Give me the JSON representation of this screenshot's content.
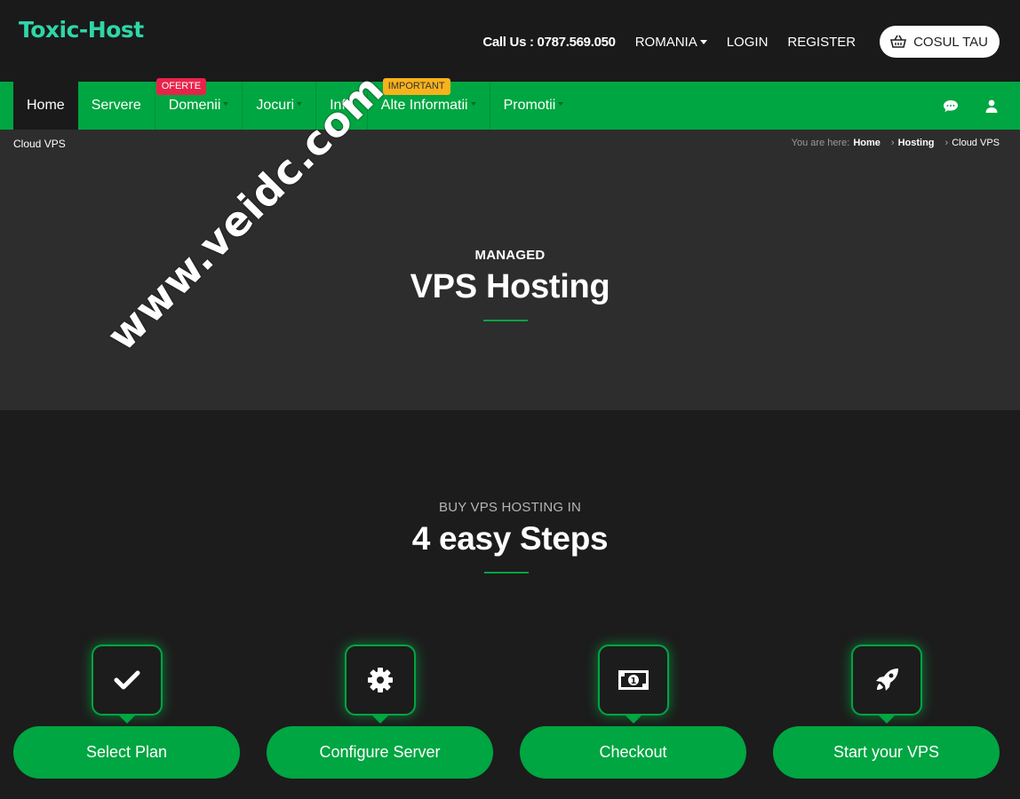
{
  "header": {
    "logo": "Toxic-Host",
    "call_us": "Call Us : 0787.569.050",
    "country": "ROMANIA",
    "login": "LOGIN",
    "register": "REGISTER",
    "cart": "COSUL TAU"
  },
  "nav": {
    "items": [
      {
        "label": "Home"
      },
      {
        "label": "Servere",
        "badge": "OFERTE"
      },
      {
        "label": "Domenii"
      },
      {
        "label": "Jocuri"
      },
      {
        "label": "Info"
      },
      {
        "label": "Alte Informatii",
        "badge": "IMPORTANT"
      },
      {
        "label": "Promotii"
      }
    ]
  },
  "breadcrumb": {
    "current_page": "Cloud VPS",
    "prefix": "You are here:",
    "items": [
      "Home",
      "Hosting",
      "Cloud VPS"
    ]
  },
  "hero": {
    "subtitle": "MANAGED",
    "title": "VPS Hosting"
  },
  "steps_section": {
    "subtitle": "BUY VPS HOSTING IN",
    "title": "4 easy Steps",
    "steps": [
      {
        "label": "Select Plan",
        "icon": "check-icon"
      },
      {
        "label": "Configure Server",
        "icon": "gear-icon"
      },
      {
        "label": "Checkout",
        "icon": "money-icon"
      },
      {
        "label": "Start your VPS",
        "icon": "rocket-icon"
      }
    ]
  },
  "watermark": "www.veidc.com",
  "colors": {
    "brand_green": "#00a641",
    "logo": "#2fd6a8",
    "badge_red": "#e8234a",
    "badge_yellow": "#f7b21c"
  }
}
